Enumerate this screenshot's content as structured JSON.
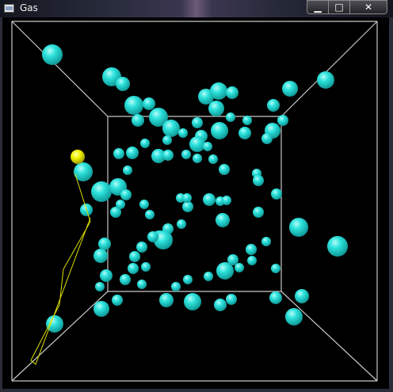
{
  "window": {
    "title": "Gas",
    "minimize_glyph": "▁",
    "maximize_glyph": "□",
    "close_glyph": "✕"
  },
  "colors": {
    "molecule": "#18d6d2",
    "tracer": "#f0f000",
    "path": "#e0e000",
    "box": "#c8c8c8",
    "background": "#000000"
  }
}
